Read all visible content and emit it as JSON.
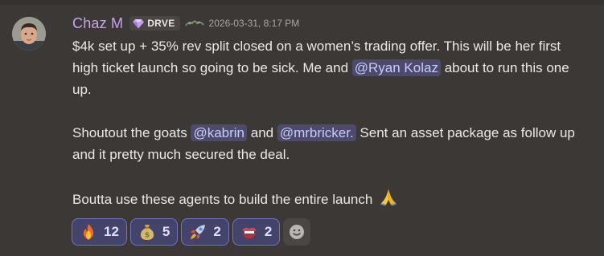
{
  "message": {
    "author": "Chaz M",
    "guild_tag": "DRVE",
    "timestamp": "2026-03-31, 8:17 PM",
    "paragraph1": {
      "text_a": "$4k set up + 35% rev split closed on a women’s trading offer. This will be her first high ticket launch so going to be sick. Me and ",
      "mention_ryan": "@Ryan Kolaz",
      "text_b": " about to run this one up."
    },
    "paragraph2": {
      "text_a": "Shoutout the goats ",
      "mention_kabrin": "@kabrin",
      "text_b": " and ",
      "mention_mrbricker": "@mrbricker.",
      "text_c": " Sent an asset package as follow up and it pretty much secured the deal."
    },
    "paragraph3": {
      "text_a": "Boutta use these agents to build the entire launch ",
      "emoji": "folded-hands-emoji"
    }
  },
  "reactions": [
    {
      "emoji": "fire-emoji",
      "count": "12"
    },
    {
      "emoji": "money-bag-emoji",
      "count": "5"
    },
    {
      "emoji": "rocket-emoji",
      "count": "2"
    },
    {
      "emoji": "biting-lip-emoji",
      "count": "2"
    }
  ],
  "add_reaction": {
    "icon": "smile-add-reaction-icon"
  },
  "colors": {
    "background": "#3b3836",
    "username": "#c7a5ec",
    "mention_bg": "#4d4a6b",
    "mention_text": "#c8cbff",
    "reaction_border": "#6f72c9",
    "reaction_bg": "#44436a"
  }
}
